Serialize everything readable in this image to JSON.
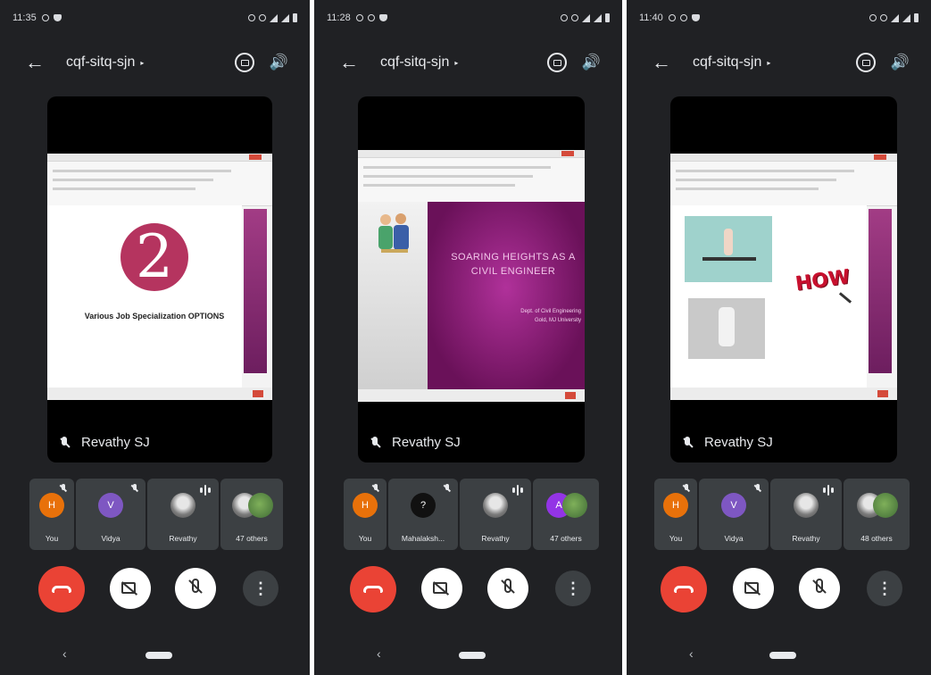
{
  "screens": [
    {
      "status_time": "11:35",
      "meeting_code": "cqf-sitq-sjn",
      "presenter": "Revathy SJ",
      "slide": {
        "number": "2",
        "text": "Various Job Specialization OPTIONS"
      },
      "participants": [
        {
          "label": "You",
          "initial": "H"
        },
        {
          "label": "Vidya",
          "initial": "V"
        },
        {
          "label": "Revathy"
        },
        {
          "label": "47 others"
        }
      ]
    },
    {
      "status_time": "11:28",
      "meeting_code": "cqf-sitq-sjn",
      "presenter": "Revathy SJ",
      "slide": {
        "title": "SOARING HEIGHTS AS A CIVIL ENGINEER",
        "sub1": "Dept. of Civil Engineering",
        "sub2": "Gold, MJ University"
      },
      "participants": [
        {
          "label": "You",
          "initial": "H"
        },
        {
          "label": "Mahalaksh...",
          "initial": "?"
        },
        {
          "label": "Revathy"
        },
        {
          "label": "47 others",
          "initial": "A"
        }
      ]
    },
    {
      "status_time": "11:40",
      "meeting_code": "cqf-sitq-sjn",
      "presenter": "Revathy SJ",
      "slide": {
        "word": "HOW"
      },
      "participants": [
        {
          "label": "You",
          "initial": "H"
        },
        {
          "label": "Vidya",
          "initial": "V"
        },
        {
          "label": "Revathy"
        },
        {
          "label": "48 others"
        }
      ]
    }
  ],
  "colors": {
    "background": "#202124",
    "end_call": "#ea4335",
    "avatar_orange": "#e8710a",
    "avatar_purple": "#7e57c2",
    "accent_magenta": "#b5345f"
  },
  "icons": [
    "back-arrow-icon",
    "dropdown-caret-icon",
    "switch-camera-icon",
    "speaker-icon",
    "mic-off-icon",
    "end-call-icon",
    "camera-off-icon",
    "more-options-icon",
    "audio-wave-icon",
    "nav-back-icon",
    "nav-home-icon"
  ],
  "ui": {
    "back_glyph": "←",
    "caret_glyph": "▸",
    "speaker_glyph": "🔊",
    "more_glyph": "⋮",
    "nav_back_glyph": "‹"
  }
}
